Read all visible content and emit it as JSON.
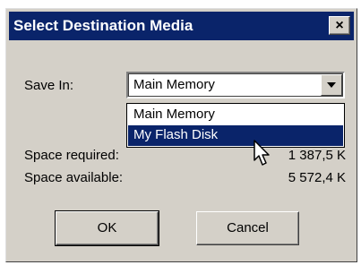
{
  "dialog": {
    "title": "Select Destination Media",
    "close_glyph": "×"
  },
  "save_in": {
    "label": "Save In:",
    "selected": "Main Memory",
    "options": [
      "Main Memory",
      "My Flash Disk"
    ]
  },
  "info": {
    "required_label": "Space required:",
    "required_value": "1 387,5 K",
    "available_label": "Space available:",
    "available_value": "5 572,4 K"
  },
  "buttons": {
    "ok": "OK",
    "cancel": "Cancel"
  },
  "colors": {
    "titlebar": "#0a246a",
    "face": "#d4d0c8",
    "highlight": "#0a246a"
  }
}
